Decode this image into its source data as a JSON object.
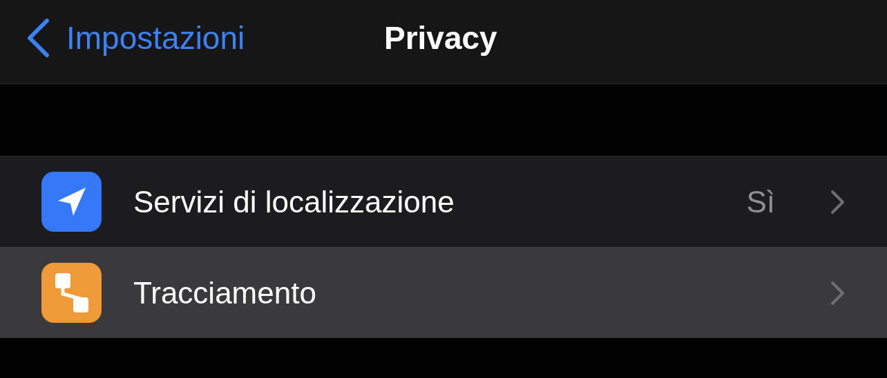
{
  "nav": {
    "back_label": "Impostazioni",
    "title": "Privacy"
  },
  "rows": [
    {
      "kind": "location",
      "label": "Servizi di localizzazione",
      "value": "Sì",
      "color": "#3478f6",
      "selected": false
    },
    {
      "kind": "tracking",
      "label": "Tracciamento",
      "color": "#f09a37",
      "selected": true
    }
  ]
}
